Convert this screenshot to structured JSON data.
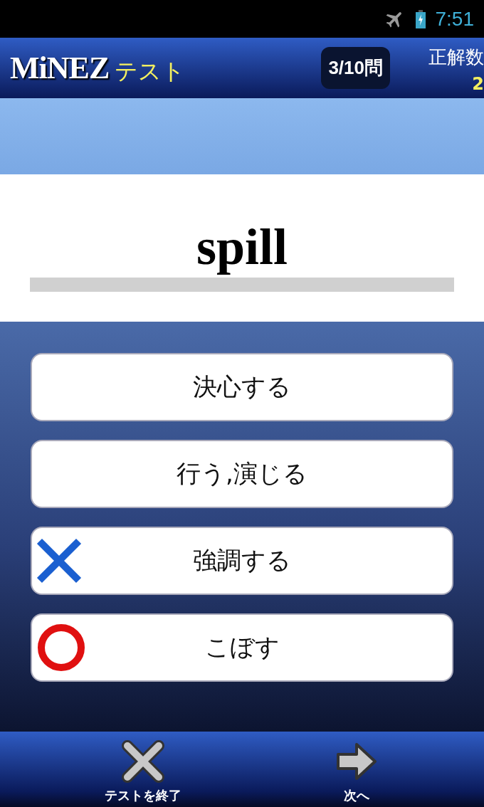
{
  "status_bar": {
    "time": "7:51"
  },
  "header": {
    "logo": "MiNEZ",
    "subtitle": "テスト",
    "progress": "3/10問",
    "score_label": "正解数",
    "score_value": "2"
  },
  "question": {
    "word": "spill"
  },
  "choices": [
    {
      "label": "決心する",
      "kind": "plain"
    },
    {
      "label": "行う,演じる",
      "kind": "plain"
    },
    {
      "label": "強調する",
      "kind": "wrong"
    },
    {
      "label": "こぼす",
      "kind": "correct"
    }
  ],
  "bottom_bar": [
    {
      "label": "テストを終了",
      "kind": "quit"
    },
    {
      "label": "次へ",
      "kind": "next"
    }
  ]
}
